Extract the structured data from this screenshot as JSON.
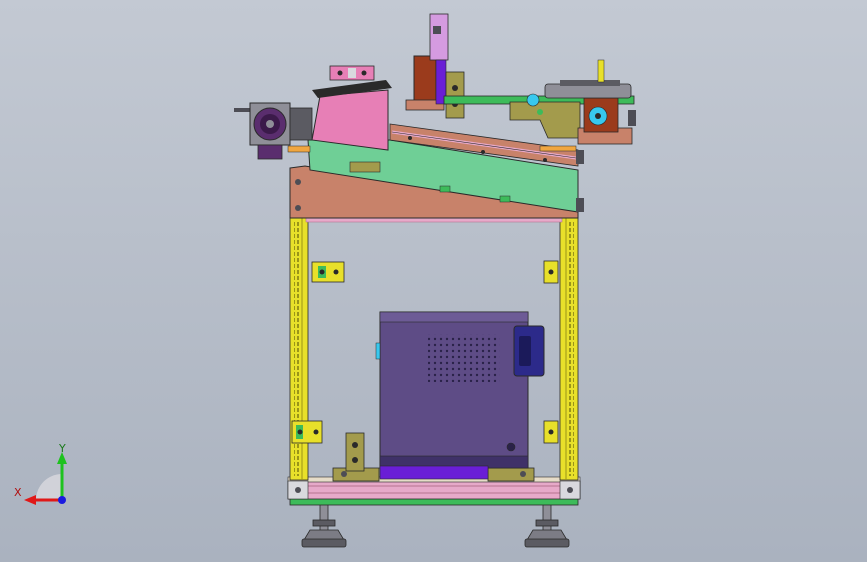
{
  "viewport": {
    "background_top": "#c3c9d3",
    "background_bottom": "#aab2bf"
  },
  "triad": {
    "x_label": "X",
    "y_label": "Y",
    "x_color": "#e01818",
    "y_color": "#1ec21e",
    "z_color": "#1a1ae0"
  },
  "colors": {
    "frame_yellow": "#e8e02a",
    "frame_shadow": "#9a9418",
    "base_plate": "#e7a9c9",
    "base_green": "#3dbb5a",
    "brown_plate": "#c8826a",
    "green_plate": "#6fcf96",
    "pink_block": "#e77fb6",
    "control_box": "#5e4c86",
    "control_box_dark": "#3f3168",
    "handle_blue": "#2c2a8a",
    "purple_strip": "#6a1ed6",
    "olive_bracket": "#a39b4c",
    "motor_purple": "#5a2d6e",
    "motor_gray": "#8f8f98",
    "orange": "#f0a640",
    "lavender": "#d59be0",
    "cylinder_brown": "#9b3b1c",
    "cyan": "#38c8ee",
    "gray_dark": "#4d4d55",
    "outline": "#2a2a2a"
  }
}
